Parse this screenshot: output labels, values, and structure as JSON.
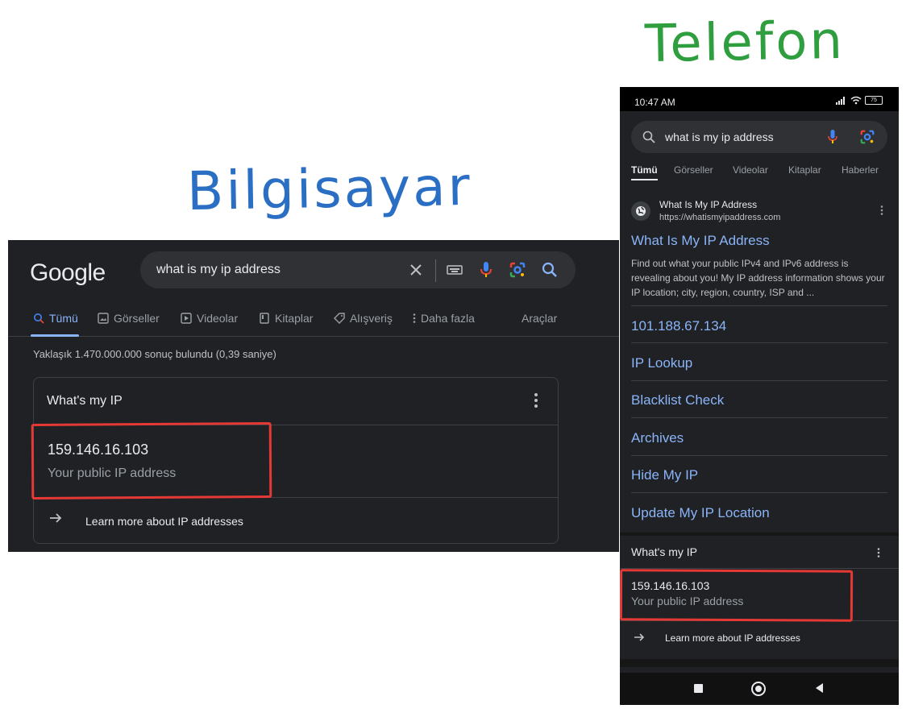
{
  "labels": {
    "desktop": "Bilgisayar",
    "phone": "Telefon"
  },
  "desktop": {
    "logo": "Google",
    "search": {
      "query": "what is my ip address"
    },
    "tabs": [
      {
        "label": "Tümü",
        "icon": "search-icon"
      },
      {
        "label": "Görseller",
        "icon": "image-icon"
      },
      {
        "label": "Videolar",
        "icon": "play-icon"
      },
      {
        "label": "Kitaplar",
        "icon": "book-icon"
      },
      {
        "label": "Alışveriş",
        "icon": "tag-icon"
      },
      {
        "label": "Daha fazla",
        "icon": "more-vert-icon"
      }
    ],
    "tools": "Araçlar",
    "stats": "Yaklaşık 1.470.000.000 sonuç bulundu (0,39 saniye)",
    "card": {
      "title": "What's my IP",
      "ip": "159.146.16.103",
      "ip_label": "Your public IP address",
      "learn_more": "Learn more about IP addresses"
    }
  },
  "phone": {
    "status": {
      "time": "10:47 AM",
      "battery": "75"
    },
    "search": {
      "query": "what is my ip address"
    },
    "tabs": [
      "Tümü",
      "Görseller",
      "Videolar",
      "Kitaplar",
      "Haberler"
    ],
    "result": {
      "site_name": "What Is My IP Address",
      "site_url": "https://whatismyipaddress.com",
      "title": "What Is My IP Address",
      "snippet": "Find out what your public IPv4 and IPv6 address is revealing about you! My IP address information shows your IP location; city, region, country, ISP and ..."
    },
    "sitelinks": [
      "101.188.67.134",
      "IP Lookup",
      "Blacklist Check",
      "Archives",
      "Hide My IP",
      "Update My IP Location"
    ],
    "card": {
      "title": "What's my IP",
      "ip": "159.146.16.103",
      "ip_label": "Your public IP address",
      "learn_more": "Learn more about IP addresses"
    }
  },
  "colors": {
    "accent": "#8ab4f8",
    "highlight": "#e53935",
    "label_blue": "#2a6fc4",
    "label_green": "#2f9e3f"
  }
}
